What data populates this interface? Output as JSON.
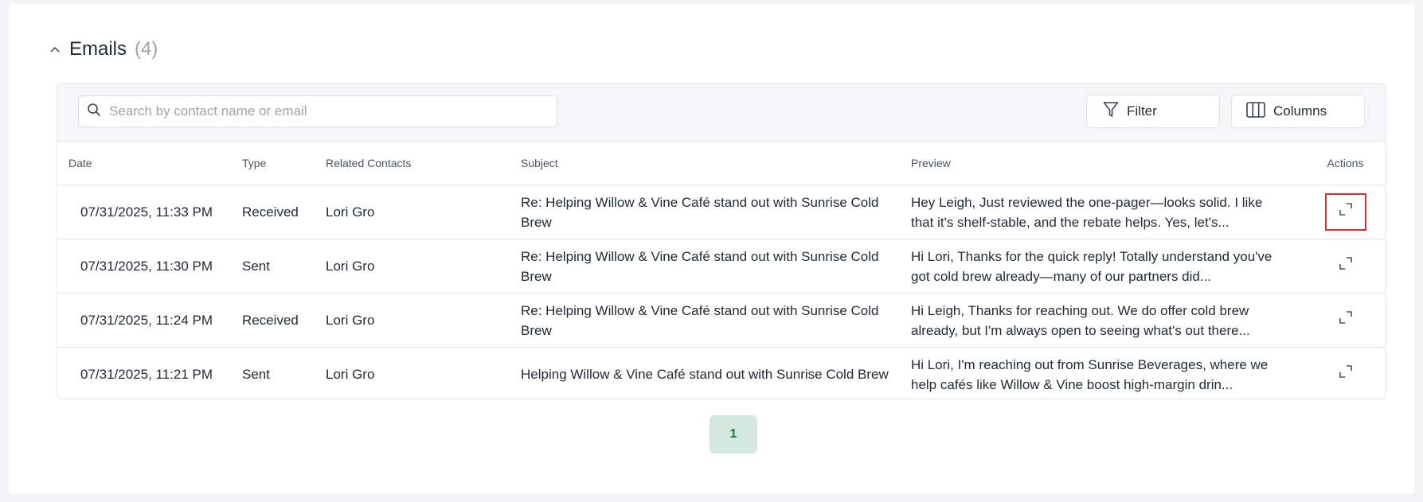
{
  "section": {
    "title": "Emails",
    "count": "(4)"
  },
  "toolbar": {
    "search_placeholder": "Search by contact name or email",
    "filter_label": "Filter",
    "columns_label": "Columns"
  },
  "table": {
    "headers": {
      "date": "Date",
      "type": "Type",
      "contacts": "Related Contacts",
      "subject": "Subject",
      "preview": "Preview",
      "actions": "Actions"
    },
    "rows": [
      {
        "date": "07/31/2025, 11:33 PM",
        "type": "Received",
        "contacts": "Lori Gro",
        "subject": "Re: Helping Willow & Vine Café stand out with Sunrise Cold Brew",
        "preview": "Hey Leigh, Just reviewed the one-pager—looks solid. I like that it's shelf-stable, and the rebate helps. Yes, let's..."
      },
      {
        "date": "07/31/2025, 11:30 PM",
        "type": "Sent",
        "contacts": "Lori Gro",
        "subject": "Re: Helping Willow & Vine Café stand out with Sunrise Cold Brew",
        "preview": "Hi Lori, Thanks for the quick reply! Totally understand you've got cold brew already—many of our partners did..."
      },
      {
        "date": "07/31/2025, 11:24 PM",
        "type": "Received",
        "contacts": "Lori Gro",
        "subject": "Re: Helping Willow & Vine Café stand out with Sunrise Cold Brew",
        "preview": "Hi Leigh, Thanks for reaching out. We do offer cold brew already, but I'm always open to seeing what's out there..."
      },
      {
        "date": "07/31/2025, 11:21 PM",
        "type": "Sent",
        "contacts": "Lori Gro",
        "subject": "Helping Willow & Vine Café stand out with Sunrise Cold Brew",
        "preview": "Hi Lori, I'm reaching out from Sunrise Beverages, where we help cafés like Willow & Vine boost high-margin drin..."
      }
    ]
  },
  "pagination": {
    "current_page": "1"
  },
  "icons": {
    "collapse": "chevron-up-icon",
    "search": "search-icon",
    "filter": "filter-funnel-icon",
    "columns": "columns-icon",
    "expand": "expand-icon"
  },
  "colors": {
    "highlight_border": "#d0312d",
    "pager_bg": "#d3e9e0",
    "pager_text": "#15803d"
  }
}
